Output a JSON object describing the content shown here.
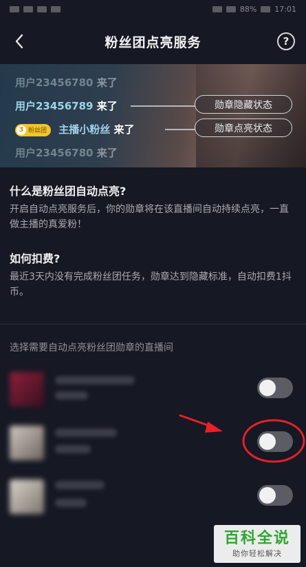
{
  "status_bar": {
    "battery": "88%",
    "time": "17:01"
  },
  "header": {
    "title": "粉丝团点亮服务",
    "help_label": "?"
  },
  "banner": {
    "messages": [
      {
        "name": "用户23456780",
        "suffix": "来了"
      },
      {
        "name": "用户23456789",
        "suffix": "来了"
      },
      {
        "name": "主播小粉丝",
        "suffix": "来了",
        "badge_level": "3",
        "badge_text": "粉丝团"
      },
      {
        "name": "用户23456780",
        "suffix": "来了"
      }
    ],
    "pill_hidden": "勋章隐藏状态",
    "pill_lit": "勋章点亮状态"
  },
  "info": {
    "q1": "什么是粉丝团自动点亮?",
    "a1": "开启自动点亮服务后，你的勋章将在该直播间自动持续点亮，一直做主播的真爱粉！",
    "q2": "如何扣费?",
    "a2": "最近3天内没有完成粉丝团任务，勋章达到隐藏标准，自动扣费1抖币。"
  },
  "list": {
    "label": "选择需要自动点亮粉丝团勋章的直播间",
    "rows": [
      {
        "enabled": false
      },
      {
        "enabled": false
      },
      {
        "enabled": false
      }
    ]
  },
  "colors": {
    "background": "#161823",
    "toggle_off": "#5b5c64",
    "annotation_red": "#e8202a",
    "badge_yellow": "#f3c52a"
  },
  "watermark": {
    "main": "百科全说",
    "sub": "助你轻松解决"
  }
}
